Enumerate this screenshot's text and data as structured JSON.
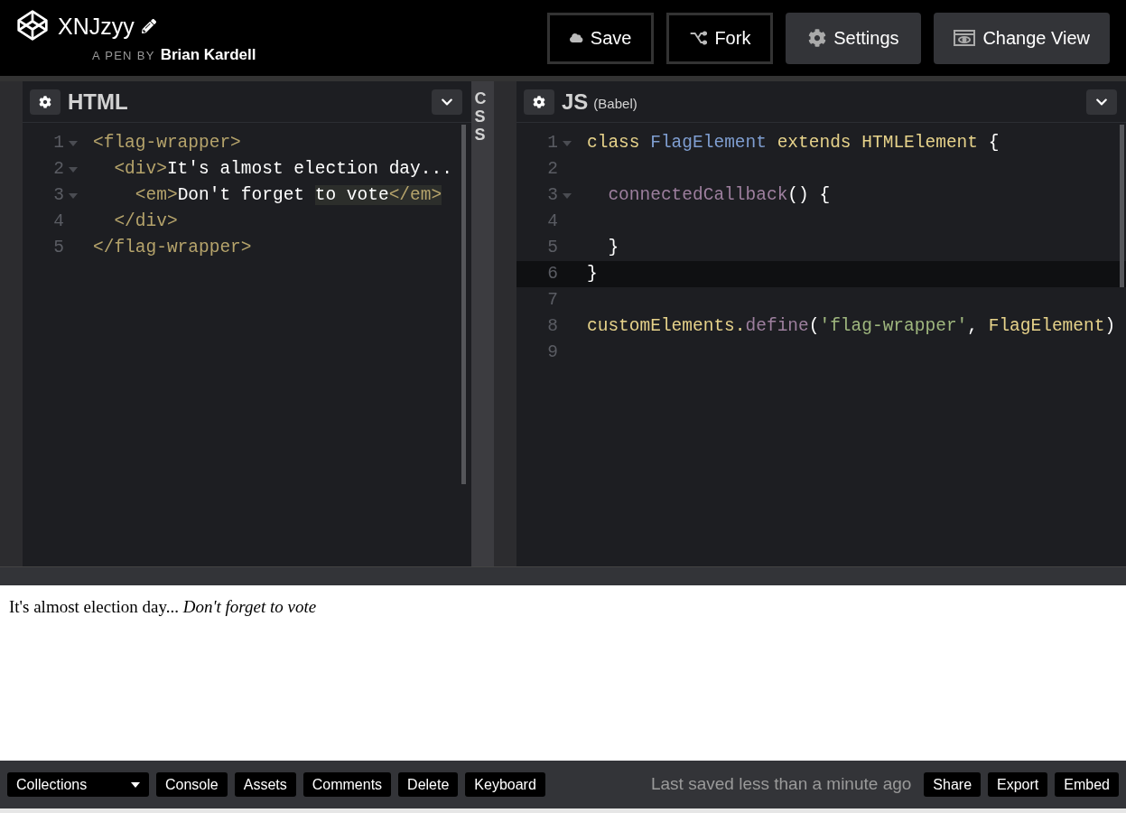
{
  "header": {
    "title": "XNJzyy",
    "byline_prefix": "A PEN BY",
    "author": "Brian Kardell",
    "buttons": [
      {
        "label": "Save",
        "kind": "outline"
      },
      {
        "label": "Fork",
        "kind": "outline"
      },
      {
        "label": "Settings",
        "kind": "filled"
      },
      {
        "label": "Change View",
        "kind": "filled"
      }
    ]
  },
  "html_editor": {
    "title": "HTML",
    "lines": [
      {
        "number": "1",
        "foldable": true,
        "active": false,
        "tokens": [
          {
            "kind": "tag",
            "text": "<flag-wrapper>"
          }
        ]
      },
      {
        "number": "2",
        "foldable": true,
        "active": false,
        "tokens": [
          {
            "kind": "tag",
            "text": "  <div>"
          },
          {
            "kind": "text",
            "text": "It's almost election day..."
          }
        ]
      },
      {
        "number": "3",
        "foldable": true,
        "active": false,
        "tokens": [
          {
            "kind": "tag",
            "text": "    <em>"
          },
          {
            "kind": "text",
            "text": "Don't forget ",
            "highlighted": false
          },
          {
            "kind": "text",
            "text": "to vote",
            "highlighted": true
          },
          {
            "kind": "tag",
            "text": "</em>",
            "highlighted": true
          }
        ]
      },
      {
        "number": "4",
        "foldable": false,
        "active": false,
        "tokens": [
          {
            "kind": "tag",
            "text": "  </div>"
          }
        ]
      },
      {
        "number": "5",
        "foldable": false,
        "active": false,
        "tokens": [
          {
            "kind": "tag",
            "text": "</flag-wrapper>"
          }
        ]
      }
    ]
  },
  "css_editor": {
    "title": "CSS"
  },
  "js_editor": {
    "title": "JS",
    "subtitle": "(Babel)",
    "lines": [
      {
        "number": "1",
        "foldable": true,
        "active": false,
        "tokens": [
          {
            "kind": "keyword",
            "text": "class "
          },
          {
            "kind": "class",
            "text": "FlagElement"
          },
          {
            "kind": "keyword",
            "text": " extends HTMLElement"
          },
          {
            "kind": "plain",
            "text": " {"
          }
        ]
      },
      {
        "number": "2",
        "foldable": false,
        "active": false
      },
      {
        "number": "3",
        "foldable": true,
        "active": false,
        "tokens": [
          {
            "kind": "method",
            "text": "  connectedCallback"
          },
          {
            "kind": "plain",
            "text": "() {"
          }
        ]
      },
      {
        "number": "4",
        "foldable": false,
        "active": false
      },
      {
        "number": "5",
        "foldable": false,
        "active": false,
        "tokens": [
          {
            "kind": "plain",
            "text": "  }"
          }
        ]
      },
      {
        "number": "6",
        "foldable": false,
        "active": true,
        "tokens": [
          {
            "kind": "plain",
            "text": "}"
          }
        ]
      },
      {
        "number": "7",
        "foldable": false,
        "active": false
      },
      {
        "number": "8",
        "foldable": false,
        "active": false,
        "tokens": [
          {
            "kind": "keyword",
            "text": "customElements."
          },
          {
            "kind": "method",
            "text": "define"
          },
          {
            "kind": "plain",
            "text": "("
          },
          {
            "kind": "string",
            "text": "'flag-wrapper'"
          },
          {
            "kind": "plain",
            "text": ", "
          },
          {
            "kind": "keyword",
            "text": "FlagElement"
          },
          {
            "kind": "plain",
            "text": ")"
          }
        ]
      },
      {
        "number": "9",
        "foldable": false,
        "active": false
      }
    ]
  },
  "preview": {
    "text": "It's almost election day...",
    "emphasis": "Don't forget to vote"
  },
  "footer": {
    "left_buttons": [
      {
        "label": "Collections",
        "kind": "dropdown"
      },
      {
        "label": "Console",
        "kind": "plain"
      },
      {
        "label": "Assets",
        "kind": "plain"
      },
      {
        "label": "Comments",
        "kind": "plain"
      },
      {
        "label": "Delete",
        "kind": "plain"
      },
      {
        "label": "Keyboard",
        "kind": "plain"
      }
    ],
    "status": "Last saved less than a minute ago",
    "right_buttons": [
      "Share",
      "Export",
      "Embed"
    ]
  }
}
